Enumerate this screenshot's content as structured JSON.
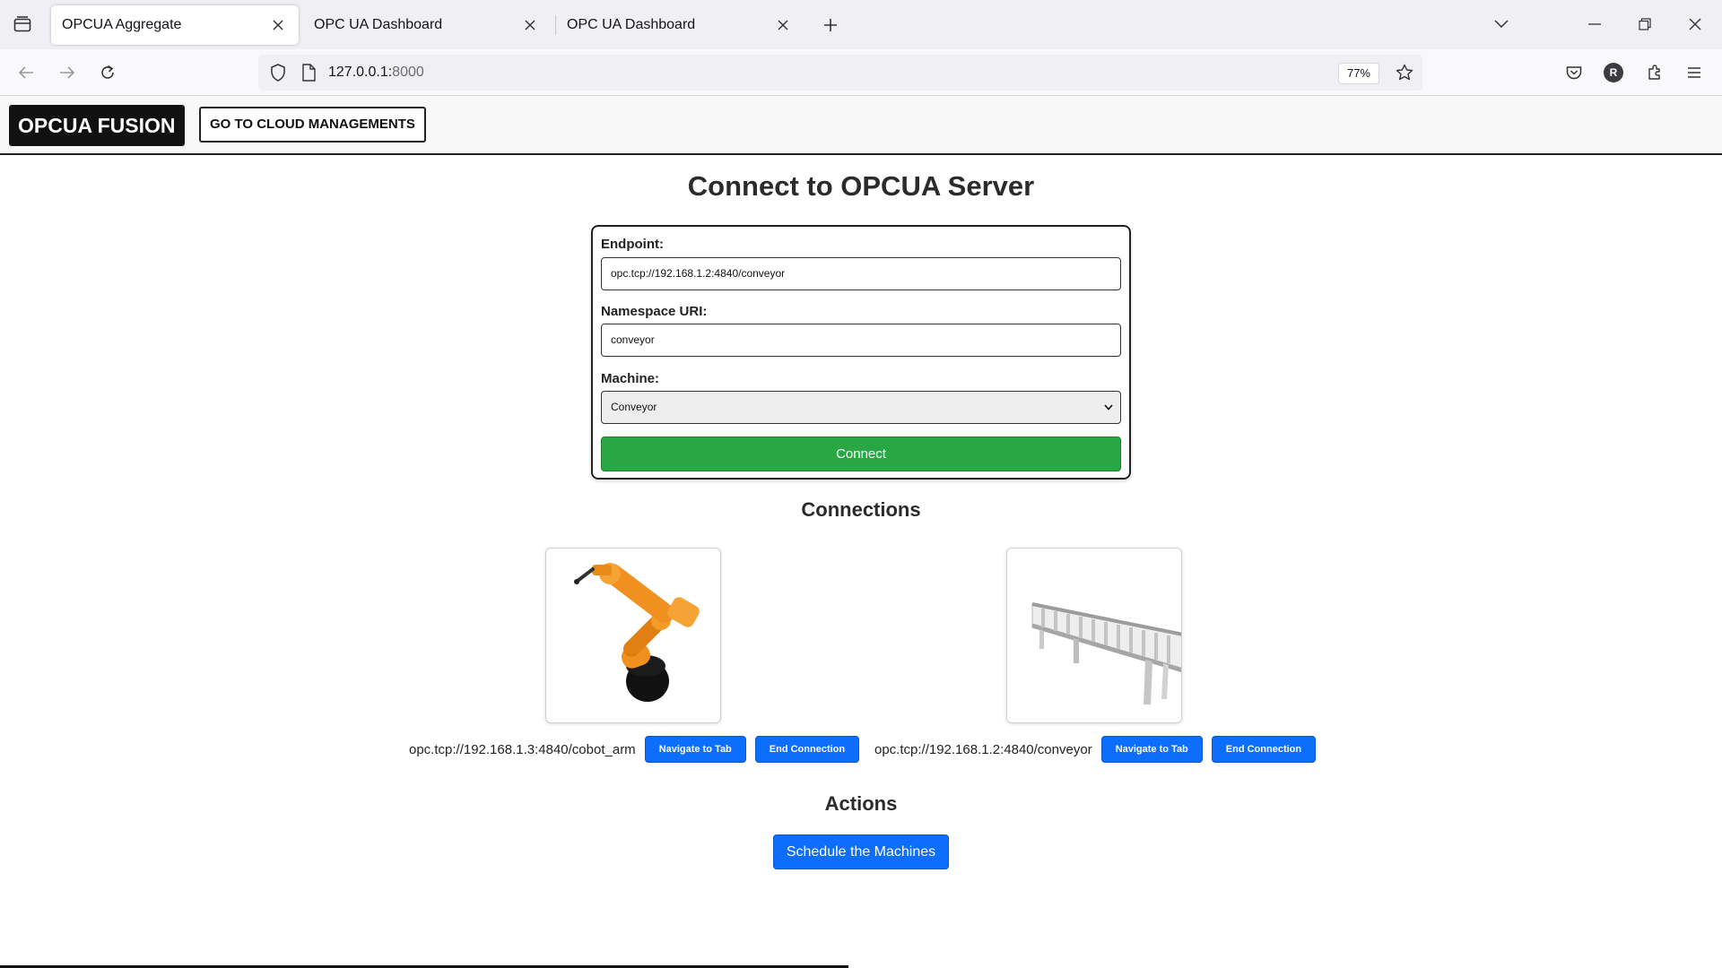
{
  "browser": {
    "tabs": [
      {
        "title": "OPCUA Aggregate",
        "active": true
      },
      {
        "title": "OPC UA Dashboard",
        "active": false
      },
      {
        "title": "OPC UA Dashboard",
        "active": false
      }
    ],
    "url_host": "127.0.0.1:",
    "url_port": "8000",
    "zoom": "77%",
    "profile_initial": "R"
  },
  "header": {
    "brand": "OPCUA FUSION",
    "cloud_button": "GO TO CLOUD MANAGEMENTS"
  },
  "main": {
    "title": "Connect to OPCUA Server",
    "form": {
      "endpoint_label": "Endpoint:",
      "endpoint_value": "opc.tcp://192.168.1.2:4840/conveyor",
      "namespace_label": "Namespace URI:",
      "namespace_value": "conveyor",
      "machine_label": "Machine:",
      "machine_selected": "Conveyor",
      "connect_label": "Connect"
    },
    "connections_title": "Connections",
    "connections": [
      {
        "endpoint": "opc.tcp://192.168.1.3:4840/cobot_arm",
        "image": "robot-arm",
        "navigate_label": "Navigate to Tab",
        "end_label": "End Connection"
      },
      {
        "endpoint": "opc.tcp://192.168.1.2:4840/conveyor",
        "image": "roller-conveyor",
        "navigate_label": "Navigate to Tab",
        "end_label": "End Connection"
      }
    ],
    "actions_title": "Actions",
    "schedule_label": "Schedule the Machines"
  },
  "colors": {
    "connect_green": "#28a745",
    "action_blue": "#0d6efd",
    "robot_orange": "#f0901e"
  }
}
